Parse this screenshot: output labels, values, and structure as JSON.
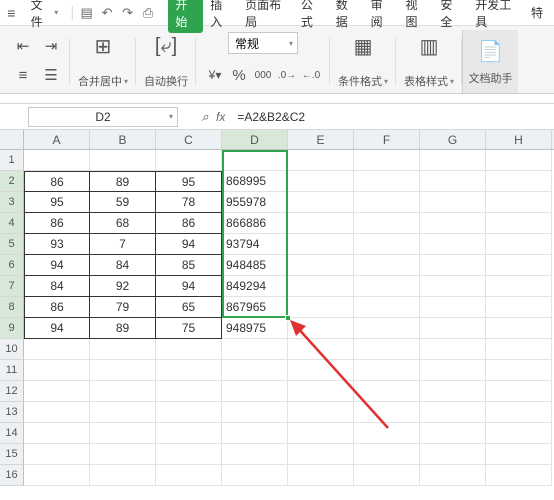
{
  "titlebar": {
    "file_label": "文件"
  },
  "tabs": [
    "开始",
    "插入",
    "页面布局",
    "公式",
    "数据",
    "审阅",
    "视图",
    "安全",
    "开发工具",
    "特"
  ],
  "active_tab_index": 0,
  "ribbon": {
    "merge_label": "合并居中",
    "wrap_label": "自动换行",
    "format_combo": "常规",
    "cond_fmt": "条件格式",
    "table_style": "表格样式",
    "doc_helper": "文档助手"
  },
  "namebox": {
    "value": "D2"
  },
  "fx_label": "fx",
  "formula": "=A2&B2&C2",
  "columns": [
    "A",
    "B",
    "C",
    "D",
    "E",
    "F",
    "G",
    "H"
  ],
  "selected_col": "D",
  "rows": [
    1,
    2,
    3,
    4,
    5,
    6,
    7,
    8,
    9,
    10,
    11,
    12,
    13,
    14,
    15,
    16
  ],
  "selected_rows": [
    2,
    3,
    4,
    5,
    6,
    7,
    8,
    9
  ],
  "chart_data": {
    "type": "table",
    "headers": [
      "A",
      "B",
      "C",
      "D"
    ],
    "rows": [
      {
        "A": 86,
        "B": 89,
        "C": 95,
        "D": "868995"
      },
      {
        "A": 95,
        "B": 59,
        "C": 78,
        "D": "955978"
      },
      {
        "A": 86,
        "B": 68,
        "C": 86,
        "D": "866886"
      },
      {
        "A": 93,
        "B": 7,
        "C": 94,
        "D": "93794"
      },
      {
        "A": 94,
        "B": 84,
        "C": 85,
        "D": "948485"
      },
      {
        "A": 84,
        "B": 92,
        "C": 94,
        "D": "849294"
      },
      {
        "A": 86,
        "B": 79,
        "C": 65,
        "D": "867965"
      },
      {
        "A": 94,
        "B": 89,
        "C": 75,
        "D": "948975"
      }
    ]
  }
}
